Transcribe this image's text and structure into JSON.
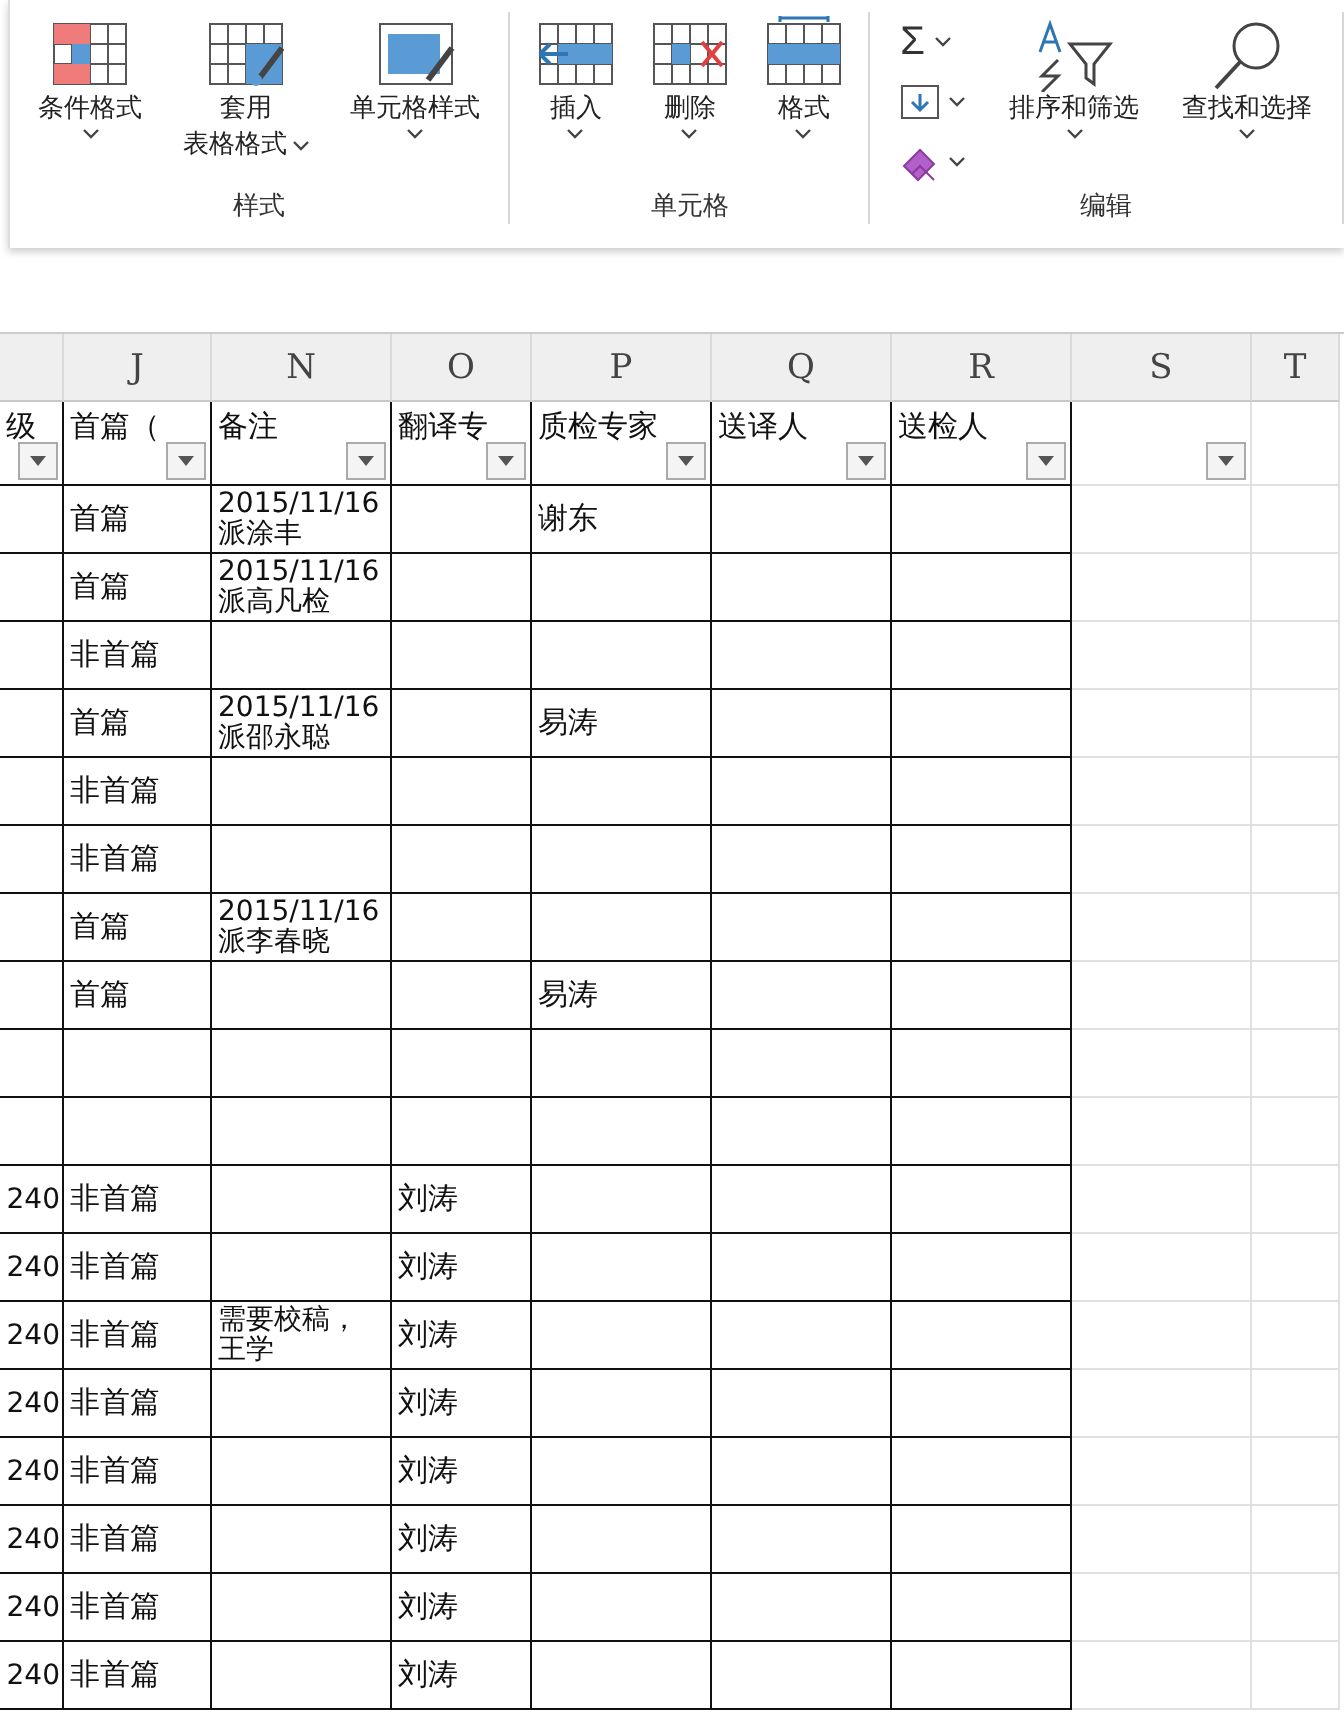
{
  "ribbon": {
    "groups": [
      {
        "kind": "style",
        "label": "样式",
        "buttons": [
          {
            "kind": "conditional",
            "lines": [
              "条件格式"
            ]
          },
          {
            "kind": "table",
            "lines": [
              "套用",
              "表格格式"
            ]
          },
          {
            "kind": "cellstyle",
            "lines": [
              "单元格样式"
            ]
          }
        ]
      },
      {
        "kind": "cells",
        "label": "单元格",
        "buttons": [
          {
            "kind": "insert",
            "lines": [
              "插入"
            ]
          },
          {
            "kind": "delete",
            "lines": [
              "删除"
            ]
          },
          {
            "kind": "format",
            "lines": [
              "格式"
            ]
          }
        ]
      },
      {
        "kind": "edit",
        "label": "编辑",
        "small": [
          {
            "kind": "sum",
            "glyph": "Σ"
          },
          {
            "kind": "fill"
          },
          {
            "kind": "clear"
          }
        ],
        "buttons": [
          {
            "kind": "sort",
            "lines": [
              "排序和筛选"
            ]
          },
          {
            "kind": "find",
            "lines": [
              "查找和选择"
            ]
          }
        ]
      }
    ]
  },
  "sheet": {
    "column_letters": [
      "J",
      "N",
      "O",
      "P",
      "Q",
      "R",
      "S",
      "T"
    ],
    "headers": [
      {
        "text": "级",
        "filter": true
      },
      {
        "text": "首篇（",
        "filter": true
      },
      {
        "text": "备注",
        "filter": true
      },
      {
        "text": "翻译专",
        "filter": true
      },
      {
        "text": "质检专家",
        "filter": true
      },
      {
        "text": "送译人",
        "filter": true
      },
      {
        "text": "送检人",
        "filter": true
      },
      {
        "filter": true
      }
    ],
    "rows": [
      {
        "J": "首篇",
        "N": "2015/11/16派涂丰",
        "P": "谢东"
      },
      {
        "J": "首篇",
        "N": "2015/11/16派高凡检"
      },
      {
        "J": "非首篇"
      },
      {
        "J": "首篇",
        "N": "2015/11/16派邵永聪",
        "P": "易涛"
      },
      {
        "J": "非首篇"
      },
      {
        "J": "非首篇"
      },
      {
        "J": "首篇",
        "N": "2015/11/16派李春晓"
      },
      {
        "J": "首篇",
        "P": "易涛"
      },
      {},
      {},
      {
        "column_1": "240",
        "J": "非首篇",
        "O": "刘涛"
      },
      {
        "column_1": "240",
        "J": "非首篇",
        "O": "刘涛"
      },
      {
        "column_1": "240",
        "J": "非首篇",
        "N": "需要校稿，王学",
        "O": "刘涛"
      },
      {
        "column_1": "240",
        "J": "非首篇",
        "O": "刘涛"
      },
      {
        "column_1": "240",
        "J": "非首篇",
        "O": "刘涛"
      },
      {
        "column_1": "240",
        "J": "非首篇",
        "O": "刘涛"
      },
      {
        "column_1": "240",
        "J": "非首篇",
        "O": "刘涛"
      },
      {
        "column_1": "240",
        "J": "非首篇",
        "O": "刘涛"
      }
    ]
  }
}
